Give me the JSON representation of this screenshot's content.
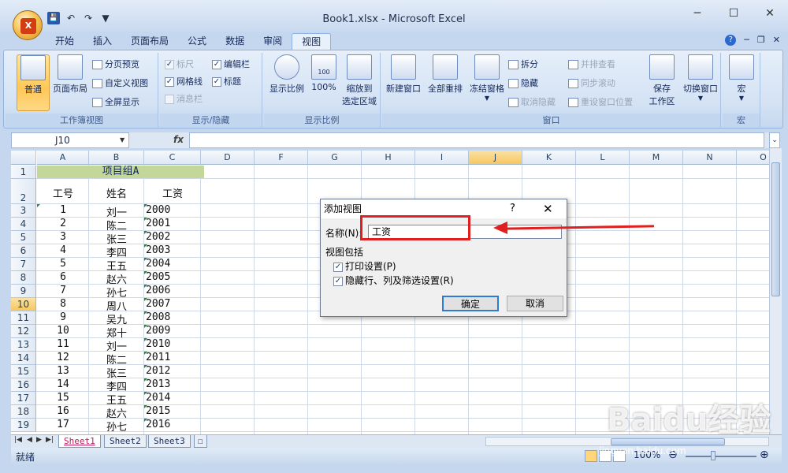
{
  "window": {
    "title": "Book1.xlsx - Microsoft Excel",
    "minimize": "─",
    "maximize": "☐",
    "close": "✕"
  },
  "office_button": {
    "logo": "X"
  },
  "qat": {
    "save": "💾",
    "undo": "↶",
    "redo": "↷",
    "extra": "▼"
  },
  "tabs": [
    "开始",
    "插入",
    "页面布局",
    "公式",
    "数据",
    "审阅",
    "视图"
  ],
  "active_tab": "视图",
  "ribbon": {
    "workbook_views": {
      "label": "工作簿视图",
      "normal": "普通",
      "page_layout": "页面布局",
      "page_break_preview": "分页预览",
      "custom_views": "自定义视图",
      "full_screen": "全屏显示"
    },
    "show_hide": {
      "label": "显示/隐藏",
      "ruler": "标尺",
      "formula_bar": "编辑栏",
      "gridlines": "网格线",
      "headings": "标题",
      "message_bar": "消息栏"
    },
    "zoom": {
      "label": "显示比例",
      "zoom": "显示比例",
      "hundred": "100%",
      "hundred_icon": "100",
      "zoom_to_selection_1": "缩放到",
      "zoom_to_selection_2": "选定区域"
    },
    "window": {
      "label": "窗口",
      "new_window": "新建窗口",
      "arrange_all": "全部重排",
      "freeze_panes": "冻结窗格",
      "split": "拆分",
      "hide": "隐藏",
      "unhide": "取消隐藏",
      "view_side_by_side": "并排查看",
      "synchronous_scrolling": "同步滚动",
      "reset_window_position": "重设窗口位置",
      "save_workspace_1": "保存",
      "save_workspace_2": "工作区",
      "switch_windows": "切换窗口"
    },
    "macros": {
      "label": "宏",
      "macros": "宏"
    }
  },
  "formula_bar": {
    "name_box": "J10",
    "fx": "fx",
    "value": ""
  },
  "columns": [
    "A",
    "B",
    "C",
    "D",
    "F",
    "G",
    "H",
    "I",
    "J",
    "K",
    "L",
    "M",
    "N",
    "O"
  ],
  "rows": [
    "1",
    "2",
    "3",
    "4",
    "5",
    "6",
    "7",
    "8",
    "9",
    "10",
    "11",
    "12",
    "13",
    "14",
    "15",
    "16",
    "17",
    "18",
    "19"
  ],
  "sheet": {
    "merged_title": "项目组A",
    "headers": [
      "工号",
      "姓名",
      "工资"
    ],
    "data": [
      [
        "1",
        "刘一",
        "2000"
      ],
      [
        "2",
        "陈二",
        "2001"
      ],
      [
        "3",
        "张三",
        "2002"
      ],
      [
        "4",
        "李四",
        "2003"
      ],
      [
        "5",
        "王五",
        "2004"
      ],
      [
        "6",
        "赵六",
        "2005"
      ],
      [
        "7",
        "孙七",
        "2006"
      ],
      [
        "8",
        "周八",
        "2007"
      ],
      [
        "9",
        "吴九",
        "2008"
      ],
      [
        "10",
        "郑十",
        "2009"
      ],
      [
        "11",
        "刘一",
        "2010"
      ],
      [
        "12",
        "陈二",
        "2011"
      ],
      [
        "13",
        "张三",
        "2012"
      ],
      [
        "14",
        "李四",
        "2013"
      ],
      [
        "15",
        "王五",
        "2014"
      ],
      [
        "16",
        "赵六",
        "2015"
      ],
      [
        "17",
        "孙七",
        "2016"
      ]
    ]
  },
  "sheet_tabs": [
    "Sheet1",
    "Sheet2",
    "Sheet3"
  ],
  "sheet_nav": [
    "|◀",
    "◀",
    "▶",
    "▶|"
  ],
  "status": {
    "ready": "就绪",
    "zoom": "100%",
    "zoom_minus": "⊖",
    "zoom_plus": "⊕"
  },
  "dialog": {
    "title": "添加视图",
    "help": "?",
    "close": "✕",
    "name_label": "名称(N):",
    "name_value": "工资",
    "include_label": "视图包括",
    "print_settings": "打印设置(P)",
    "hidden_rows": "隐藏行、列及筛选设置(R)",
    "ok": "确定",
    "cancel": "取消"
  },
  "watermark": {
    "brand": "Baidu经验",
    "url": "jingyan.baidu.com"
  }
}
